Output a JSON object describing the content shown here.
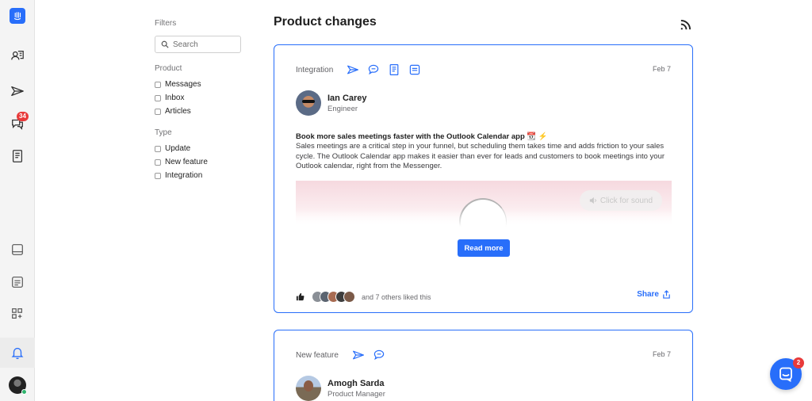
{
  "colors": {
    "accent": "#286efa",
    "badge": "#e83a3a",
    "rail_bg": "#f4f4f4"
  },
  "nav": {
    "items": [
      {
        "icon": "intercom-logo-icon"
      },
      {
        "icon": "contacts-icon"
      },
      {
        "icon": "outbound-send-icon"
      },
      {
        "icon": "inbox-chat-icon",
        "badge": "34"
      },
      {
        "icon": "articles-book-icon"
      },
      {
        "icon": "messages-icon"
      },
      {
        "icon": "reports-icon"
      },
      {
        "icon": "apps-grid-icon"
      },
      {
        "icon": "product-changes-bell-icon"
      },
      {
        "icon": "user-avatar"
      }
    ]
  },
  "filters": {
    "title": "Filters",
    "search_placeholder": "Search",
    "product_title": "Product",
    "product_options": [
      "Messages",
      "Inbox",
      "Articles"
    ],
    "type_title": "Type",
    "type_options": [
      "Update",
      "New feature",
      "Integration"
    ]
  },
  "page": {
    "title": "Product changes",
    "rss_icon": "rss-icon"
  },
  "posts": [
    {
      "category": "Integration",
      "category_icons": [
        "outbound-send-icon",
        "chat-bubble-icon",
        "article-icon",
        "messages-window-icon"
      ],
      "date": "Feb 7",
      "author_name": "Ian Carey",
      "author_role": "Engineer",
      "title": "Book more sales meetings faster with the Outlook Calendar app 📆 ⚡",
      "body": "Sales meetings are a critical step in your funnel, but scheduling them takes time and adds friction to your sales cycle. The Outlook Calendar app makes it easier than ever for leads and customers to book meetings into your Outlook calendar, right from the Messenger.",
      "media_sound_label": "Click for sound",
      "read_more": "Read more",
      "likes_text": "and 7 others liked this",
      "share_label": "Share"
    },
    {
      "category": "New feature",
      "category_icons": [
        "outbound-send-icon",
        "chat-bubble-icon"
      ],
      "date": "Feb 7",
      "author_name": "Amogh Sarda",
      "author_role": "Product Manager"
    }
  ],
  "launcher": {
    "icon": "messenger-launcher-icon",
    "badge": "2"
  }
}
